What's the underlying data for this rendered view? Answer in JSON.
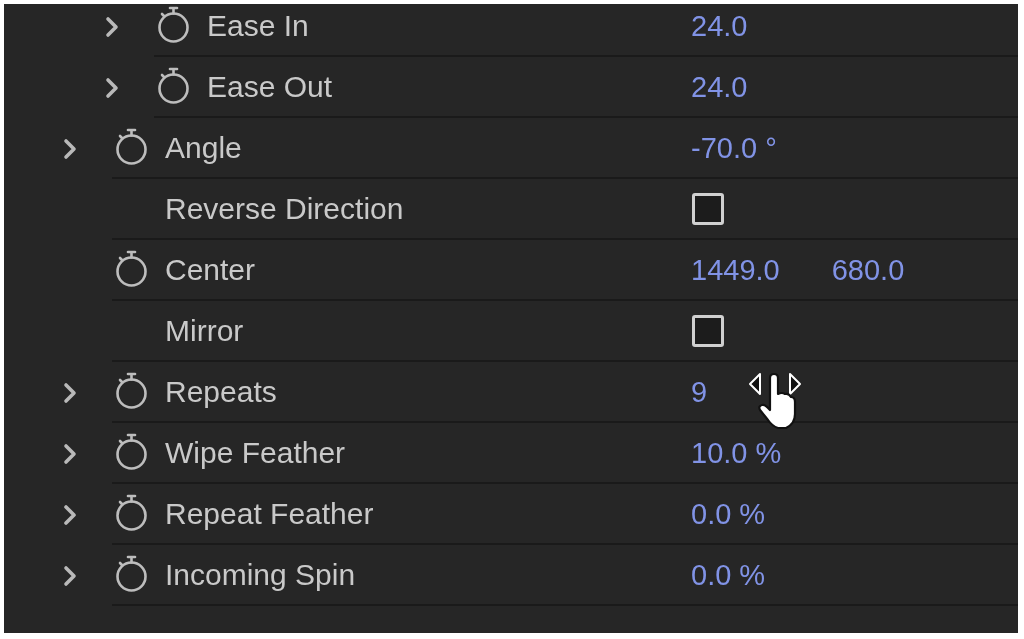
{
  "effect_controls": {
    "properties": [
      {
        "kind": "group",
        "children": [
          {
            "label": "Ease In",
            "kind": "number",
            "expanded": false,
            "stopwatch": true,
            "value": "24.0",
            "hovered": false
          },
          {
            "label": "Ease Out",
            "kind": "number",
            "expanded": false,
            "stopwatch": true,
            "value": "24.0",
            "hovered": false
          }
        ]
      },
      {
        "label": "Angle",
        "kind": "number",
        "expanded": false,
        "stopwatch": true,
        "value": "-70.0 °",
        "hovered": false
      },
      {
        "label": "Reverse Direction",
        "kind": "checkbox",
        "stopwatch": false,
        "checked": false,
        "hovered": false
      },
      {
        "label": "Center",
        "kind": "point",
        "stopwatch": true,
        "values": [
          "1449.0",
          "680.0"
        ],
        "hovered": false
      },
      {
        "label": "Mirror",
        "kind": "checkbox",
        "stopwatch": false,
        "checked": false,
        "hovered": false
      },
      {
        "label": "Repeats",
        "kind": "number",
        "expanded": false,
        "stopwatch": true,
        "value": "9",
        "hovered": true
      },
      {
        "label": "Wipe Feather",
        "kind": "number",
        "expanded": false,
        "stopwatch": true,
        "value": "10.0 %",
        "hovered": false
      },
      {
        "label": "Repeat Feather",
        "kind": "number",
        "expanded": false,
        "stopwatch": true,
        "value": "0.0 %",
        "hovered": false
      },
      {
        "label": "Incoming Spin",
        "kind": "number",
        "expanded": false,
        "stopwatch": true,
        "value": "0.0 %",
        "hovered": false
      }
    ]
  }
}
